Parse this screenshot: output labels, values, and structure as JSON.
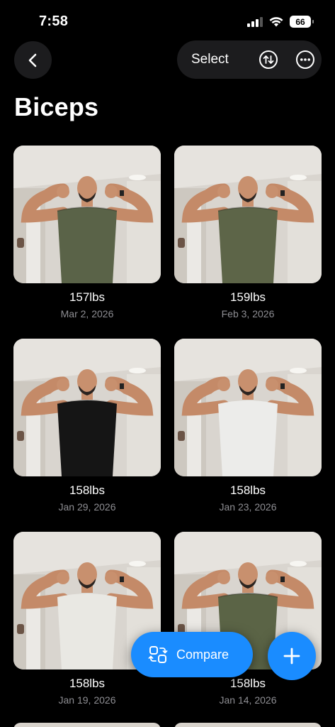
{
  "status_bar": {
    "time": "7:58",
    "battery": "66"
  },
  "header": {
    "select_label": "Select",
    "title": "Biceps"
  },
  "photos": [
    {
      "weight": "157lbs",
      "date": "Mar 2, 2026",
      "shirt": "#5a6348"
    },
    {
      "weight": "159lbs",
      "date": "Feb 3, 2026",
      "shirt": "#5d6548"
    },
    {
      "weight": "158lbs",
      "date": "Jan 29, 2026",
      "shirt": "#151515"
    },
    {
      "weight": "158lbs",
      "date": "Jan 23, 2026",
      "shirt": "#ececea"
    },
    {
      "weight": "158lbs",
      "date": "Jan 19, 2026",
      "shirt": "#e9e8e3"
    },
    {
      "weight": "158lbs",
      "date": "Jan 14, 2026",
      "shirt": "#5b6446"
    }
  ],
  "actions": {
    "compare_label": "Compare"
  },
  "colors": {
    "accent": "#1a8cff",
    "background": "#000000",
    "secondary_text": "#8e8e93"
  }
}
